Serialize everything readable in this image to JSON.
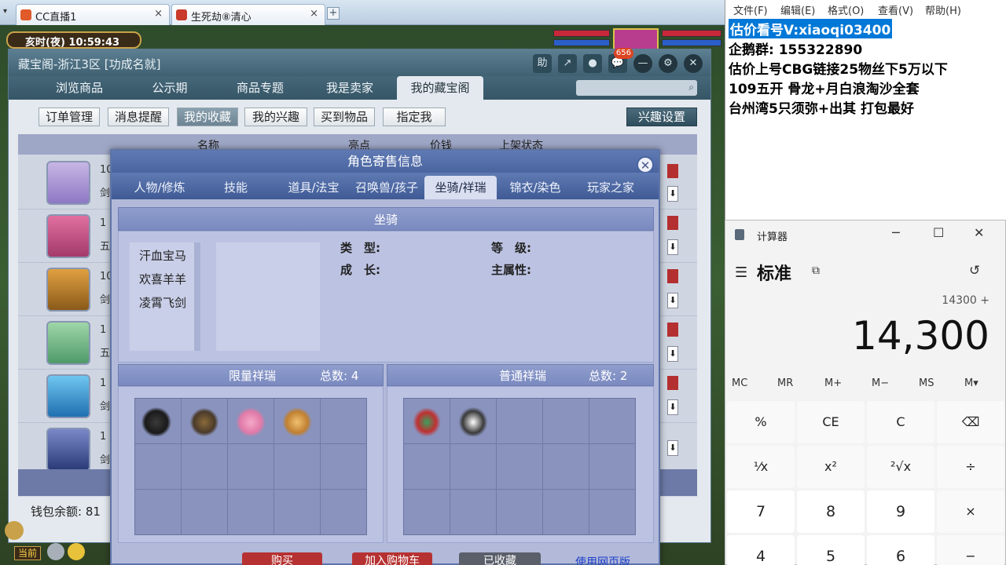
{
  "browser": {
    "tabs": [
      {
        "title": "CC直播1",
        "close": "×"
      },
      {
        "title": "生死劫⑧清心",
        "close": "×"
      }
    ],
    "new_tab": "+"
  },
  "game": {
    "time": "亥时(夜)  10:59:43",
    "bottom_label": "当前"
  },
  "cbg": {
    "title": "藏宝阁-浙江3区 [功成名就]",
    "title_icons": [
      "助",
      "↗",
      "●",
      "💬",
      "—",
      "⚙",
      "✕"
    ],
    "message_badge": "656",
    "nav_tabs": [
      "浏览商品",
      "公示期",
      "商品专题",
      "我是卖家",
      "我的藏宝阁"
    ],
    "sub_buttons": [
      "订单管理",
      "消息提醒",
      "我的收藏",
      "我的兴趣",
      "买到物品",
      "指定我"
    ],
    "interest_button": "兴趣设置",
    "list_headers": [
      "名称",
      "亮点",
      "价钱",
      "上架状态"
    ],
    "rows": [
      {
        "num": "10",
        "sub": "剑"
      },
      {
        "num": "1",
        "sub": "五"
      },
      {
        "num": "10",
        "sub": "剑"
      },
      {
        "num": "1",
        "sub": "五"
      },
      {
        "num": "1",
        "sub": "剑"
      },
      {
        "num": "1",
        "sub": "剑"
      }
    ],
    "down_arrow": "⬇",
    "wallet": "钱包余额: 81"
  },
  "modal": {
    "title": "角色寄售信息",
    "close": "✕",
    "tabs": [
      "人物/修炼",
      "技能",
      "道具/法宝",
      "召唤兽/孩子",
      "坐骑/祥瑞",
      "锦衣/染色",
      "玩家之家"
    ],
    "active_tab": "坐骑/祥瑞",
    "section_title": "坐骑",
    "mounts": [
      "汗血宝马",
      "欢喜羊羊",
      "凌霄飞剑"
    ],
    "labels": {
      "type": "类　型:",
      "growth": "成　长:",
      "level": "等　级:",
      "main_attr": "主属性:"
    },
    "limited": {
      "title": "限量祥瑞",
      "total": "总数: 4"
    },
    "normal": {
      "title": "普通祥瑞",
      "total": "总数: 2"
    },
    "buttons": [
      "购买",
      "加入购物车",
      "已收藏"
    ],
    "web_link": "使用网页版"
  },
  "notepad": {
    "menu": [
      "文件(F)",
      "编辑(E)",
      "格式(O)",
      "查看(V)",
      "帮助(H)"
    ],
    "lines": [
      "估价看号V:xiaoqi03400",
      "企鹅群: 155322890",
      "估价上号CBG链接25物丝下5万以下",
      "109五开 骨龙+月白浪淘沙全套",
      "台州湾5只须弥+出其 打包最好"
    ]
  },
  "calculator": {
    "title": "计算器",
    "mode": "标准",
    "expression": "14300 +",
    "display": "14,300",
    "memory": [
      "MC",
      "MR",
      "M+",
      "M−",
      "MS",
      "M▾"
    ],
    "keys": [
      "%",
      "CE",
      "C",
      "⌫",
      "⅟x",
      "x²",
      "²√x",
      "÷",
      "7",
      "8",
      "9",
      "×",
      "4",
      "5",
      "6",
      "−"
    ]
  }
}
